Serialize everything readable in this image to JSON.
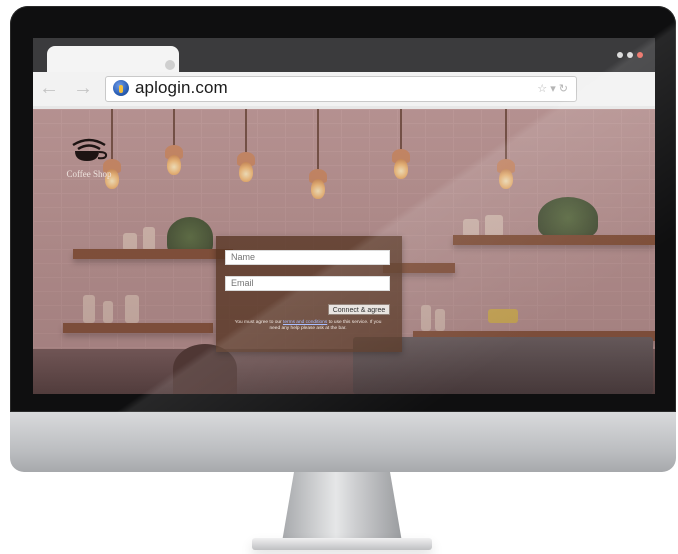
{
  "browser": {
    "url": "aplogin.com",
    "nav": {
      "back_glyph": "←",
      "forward_glyph": "→"
    },
    "address_icons": "☆ ▾ ↻"
  },
  "brand": {
    "logo_icon": "wifi-coffee-cup-icon",
    "logo_text": "Coffee Shop"
  },
  "login": {
    "name_placeholder": "Name",
    "email_placeholder": "Email",
    "connect_label": "Connect & agree",
    "terms_prefix": "You must agree to our",
    "terms_link": "terms and conditions",
    "terms_middle": "to use this service. If you need any help",
    "terms_suffix": "please ask at the bar."
  },
  "colors": {
    "panel": "#56341f",
    "browser_frame": "#3b3b3d",
    "address_bar": "#ffffff",
    "window_close": "#ec6d62"
  }
}
